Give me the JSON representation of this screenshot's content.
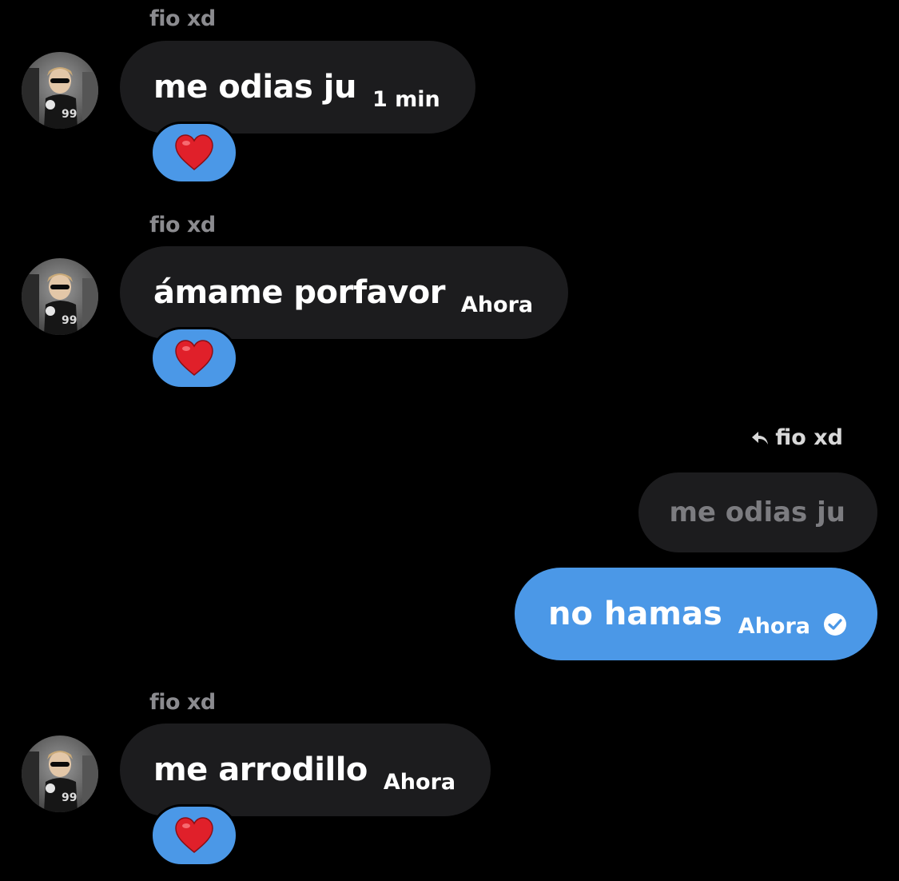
{
  "messages": [
    {
      "sender": "fio xd",
      "text": "me odias ju",
      "time": "1 min",
      "reaction": "❤️"
    },
    {
      "sender": "fio xd",
      "text": "ámame porfavor",
      "time": "Ahora",
      "reaction": "❤️"
    },
    {
      "sender": "fio xd",
      "text": "me arrodillo",
      "time": "Ahora",
      "reaction": "❤️"
    }
  ],
  "reply": {
    "label": "fio xd",
    "quoted_text": "me odias ju",
    "text": "no hamas",
    "time": "Ahora"
  },
  "colors": {
    "background": "#000000",
    "incoming_bubble": "#1c1c1e",
    "outgoing_bubble": "#4b98e7",
    "sender_name": "#8b8b8f"
  },
  "icons": {
    "reply": "reply-arrow-icon",
    "read_receipt": "check-circle-icon",
    "reaction": "red-heart-icon"
  }
}
